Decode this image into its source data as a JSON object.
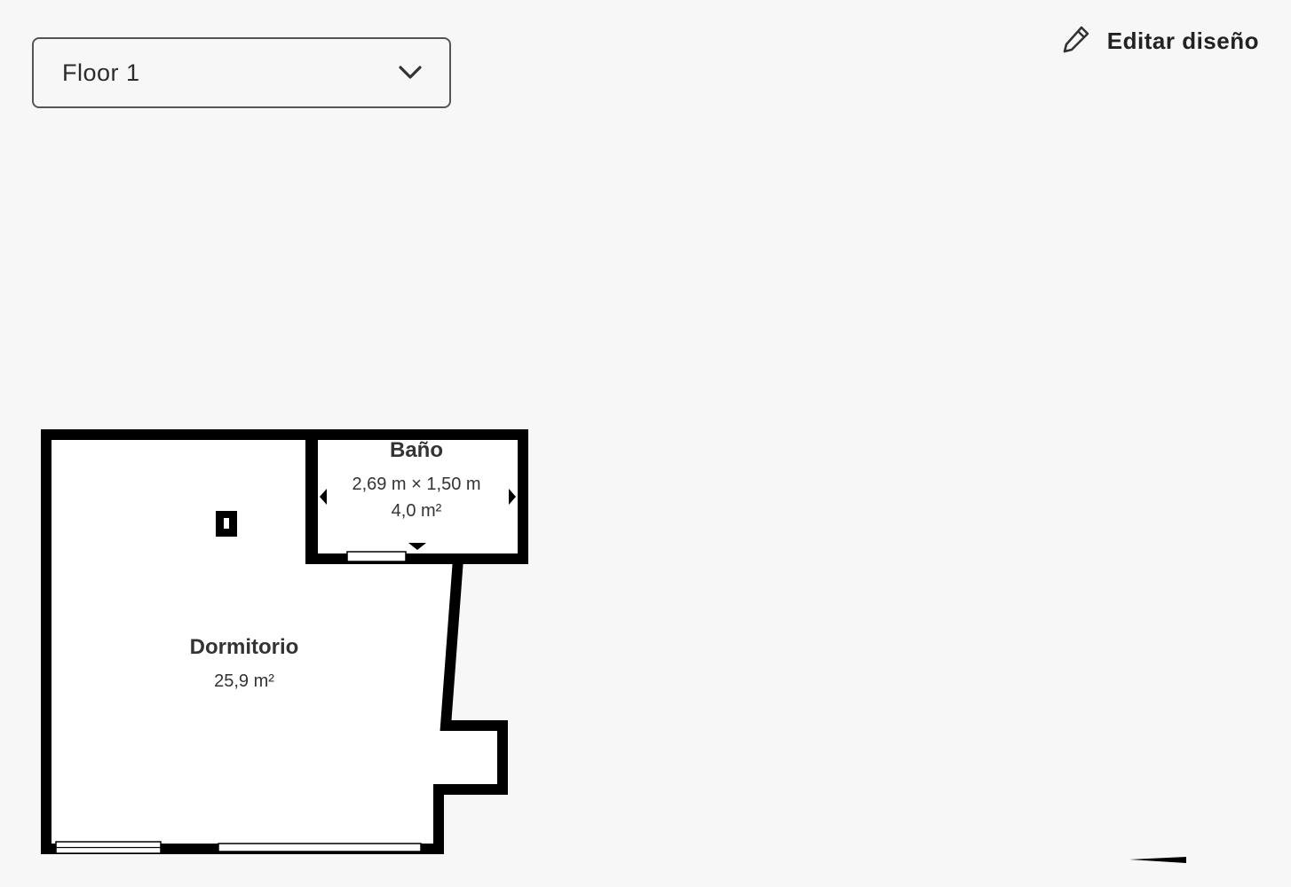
{
  "floor_selector": {
    "value": "Floor 1",
    "icon": "chevron-down-icon"
  },
  "edit_layout": {
    "label": "Editar diseño",
    "icon": "pencil-icon"
  },
  "rooms": [
    {
      "name": "Baño",
      "dimensions": "2,69 m × 1,50 m",
      "area": "4,0 m²"
    },
    {
      "name": "Dormitorio",
      "area": "25,9 m²"
    }
  ]
}
